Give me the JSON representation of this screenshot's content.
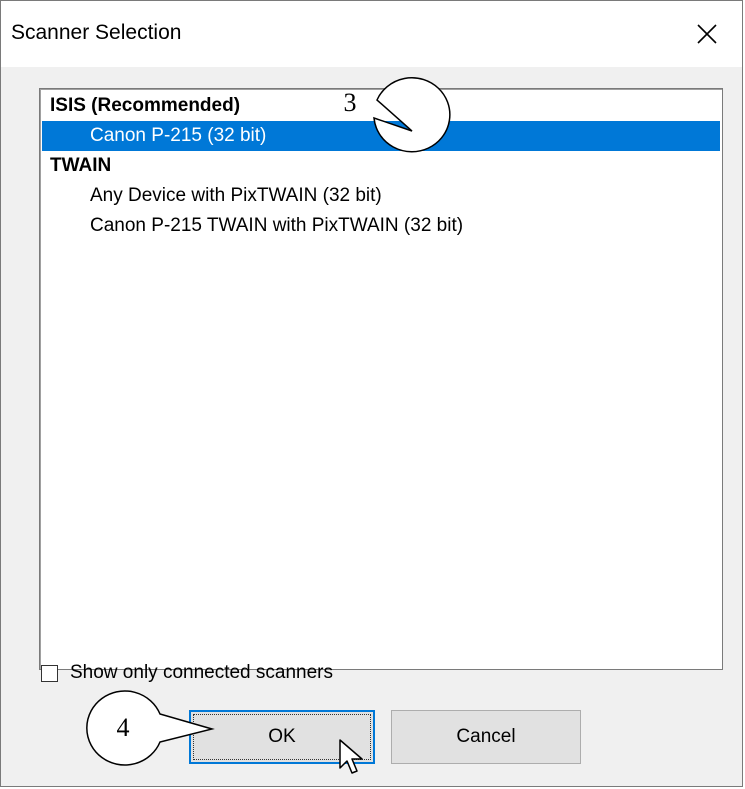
{
  "window": {
    "title": "Scanner Selection",
    "close_glyph": "✕"
  },
  "list": {
    "rows": [
      {
        "label": "ISIS (Recommended)",
        "kind": "group"
      },
      {
        "label": "Canon P-215 (32 bit)",
        "kind": "item",
        "selected": true
      },
      {
        "label": "TWAIN",
        "kind": "group"
      },
      {
        "label": "Any Device with PixTWAIN (32 bit)",
        "kind": "item"
      },
      {
        "label": "Canon P-215 TWAIN with PixTWAIN (32 bit)",
        "kind": "item"
      }
    ]
  },
  "options": {
    "connected_only_label": "Show only connected scanners",
    "connected_only_checked": false
  },
  "buttons": {
    "ok_label": "OK",
    "cancel_label": "Cancel"
  },
  "callouts": {
    "step3": "3",
    "step4": "4"
  },
  "colors": {
    "selection": "#0078d7",
    "dialog_bg": "#f0f0f0"
  }
}
